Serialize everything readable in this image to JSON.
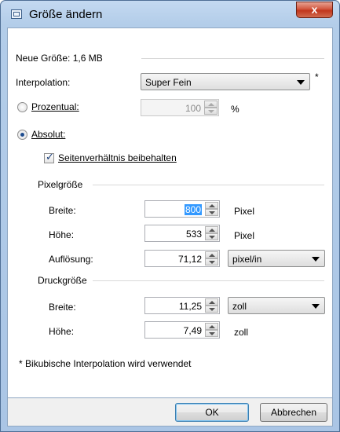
{
  "window": {
    "title": "Größe ändern",
    "close_label": "x"
  },
  "info": {
    "new_size": "Neue Größe: 1,6 MB"
  },
  "interpolation": {
    "label": "Interpolation:",
    "value": "Super Fein",
    "marker": "*"
  },
  "percent": {
    "label": "Prozentual:",
    "value": "100",
    "unit": "%",
    "checked": false
  },
  "absolute": {
    "label": "Absolut:",
    "checked": true
  },
  "keep_ratio": {
    "label": "Seitenverhältnis beibehalten",
    "checked": true
  },
  "pixel_size": {
    "title": "Pixelgröße",
    "width_label": "Breite:",
    "width_value": "800",
    "width_unit": "Pixel",
    "height_label": "Höhe:",
    "height_value": "533",
    "height_unit": "Pixel",
    "res_label": "Auflösung:",
    "res_value": "71,12",
    "res_unit": "pixel/in"
  },
  "print_size": {
    "title": "Druckgröße",
    "width_label": "Breite:",
    "width_value": "11,25",
    "width_unit": "zoll",
    "height_label": "Höhe:",
    "height_value": "7,49",
    "height_unit": "zoll"
  },
  "footnote": "* Bikubische Interpolation wird verwendet",
  "buttons": {
    "ok": "OK",
    "cancel": "Abbrechen"
  }
}
